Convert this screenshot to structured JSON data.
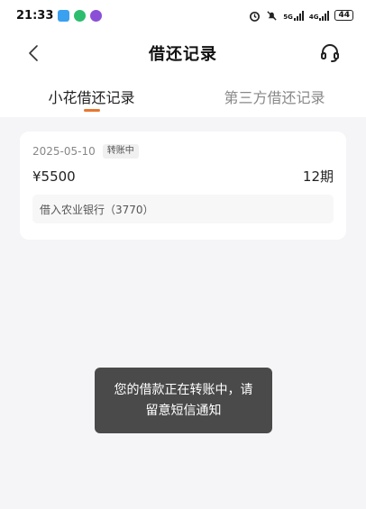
{
  "status_bar": {
    "time": "21:33",
    "net_5g": "5G",
    "net_4g": "4G",
    "battery": "44"
  },
  "header": {
    "title": "借还记录"
  },
  "tabs": [
    {
      "label": "小花借还记录",
      "active": true
    },
    {
      "label": "第三方借还记录",
      "active": false
    }
  ],
  "records": [
    {
      "date": "2025-05-10",
      "status": "转账中",
      "amount": "¥5500",
      "periods": "12期",
      "bank": "借入农业银行（3770）"
    }
  ],
  "toast": {
    "line1": "您的借款正在转账中，请",
    "line2": "留意短信通知"
  },
  "colors": {
    "accent": "#e8772e",
    "background": "#f5f5f7"
  }
}
